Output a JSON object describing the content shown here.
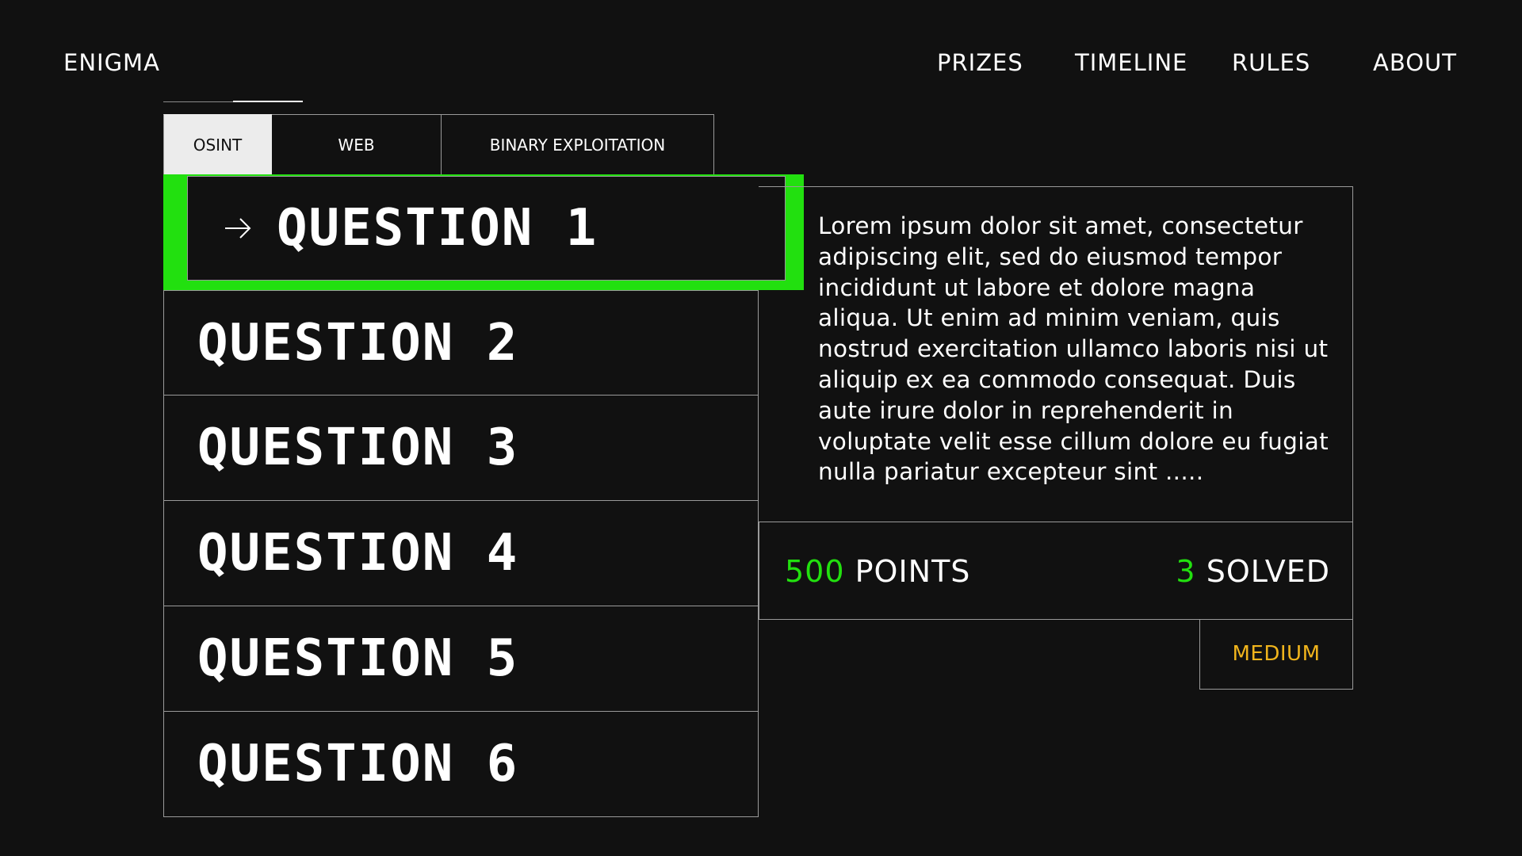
{
  "header": {
    "brand": "ENIGMA",
    "nav": [
      "PRIZES",
      "TIMELINE",
      "RULES",
      "ABOUT"
    ]
  },
  "tabs": [
    {
      "label": "OSINT",
      "active": true
    },
    {
      "label": "WEB",
      "active": false
    },
    {
      "label": "BINARY EXPLOITATION",
      "active": false
    }
  ],
  "questions": {
    "active": "QUESTION 1",
    "items": [
      "QUESTION 2",
      "QUESTION 3",
      "QUESTION 4",
      "QUESTION 5",
      "QUESTION 6"
    ]
  },
  "detail": {
    "description": "Lorem ipsum dolor sit amet, consectetur adipiscing elit, sed do eiusmod tempor incididunt ut labore et dolore magna aliqua. Ut enim ad minim veniam, quis nostrud exercitation ullamco laboris nisi ut aliquip ex ea commodo consequat. Duis aute irure dolor in reprehenderit in voluptate velit esse cillum dolore eu fugiat nulla pariatur excepteur sint .....",
    "points_value": "500",
    "points_label": "POINTS",
    "solved_value": "3",
    "solved_label": "SOLVED",
    "difficulty": "MEDIUM"
  },
  "colors": {
    "accent": "#22e00f",
    "difficulty": "#f0b41c",
    "background": "#111111",
    "tab_active_bg": "#ececec"
  },
  "icons": {
    "active_question": "arrow-right-icon"
  }
}
